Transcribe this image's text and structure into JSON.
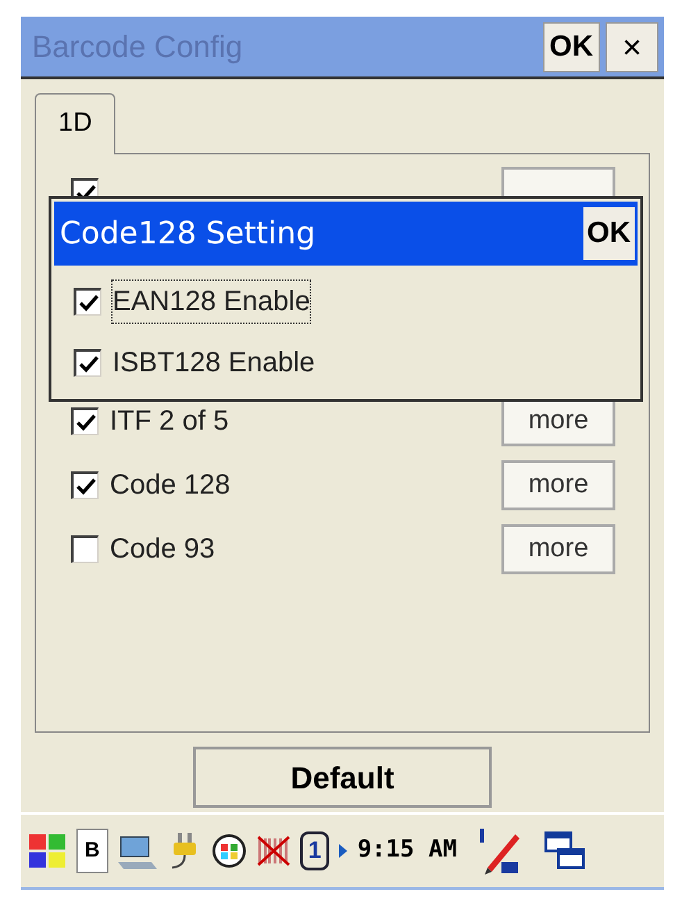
{
  "window": {
    "title": "Barcode Config",
    "ok": "OK",
    "close": "×"
  },
  "tabs": [
    {
      "label": "1D",
      "selected": true
    }
  ],
  "covered_option": {
    "checked": true
  },
  "options": [
    {
      "label": "ITF 2 of 5",
      "checked": true,
      "button": "more"
    },
    {
      "label": "Code 128",
      "checked": true,
      "button": "more"
    },
    {
      "label": "Code 93",
      "checked": false,
      "button": "more"
    }
  ],
  "dialog": {
    "title": "Code128 Setting",
    "ok": "OK",
    "options": [
      {
        "label": "EAN128 Enable",
        "checked": true,
        "focused": true
      },
      {
        "label": "ISBT128 Enable",
        "checked": true,
        "focused": false
      }
    ]
  },
  "default_button": "Default",
  "taskbar": {
    "input": "B",
    "indicator": "1",
    "time": "9:15 AM"
  }
}
